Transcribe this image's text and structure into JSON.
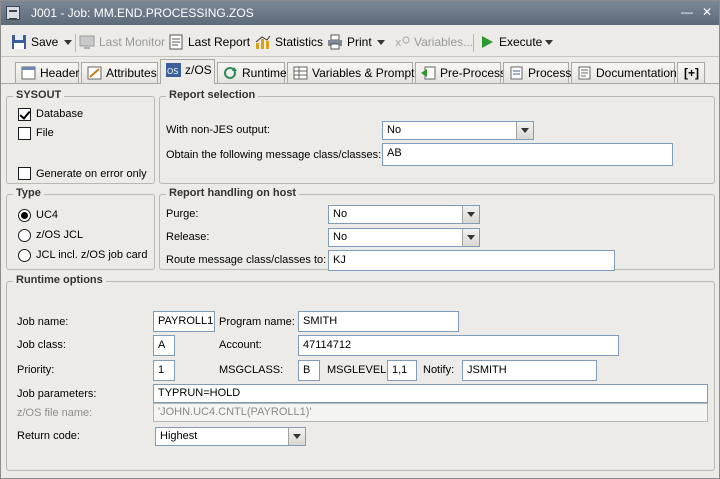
{
  "window": {
    "title": "J001 - Job: MM.END.PROCESSING.ZOS",
    "minimize": "—",
    "close": "✕"
  },
  "toolbar": {
    "save": "Save",
    "last_monitor": "Last Monitor",
    "last_report": "Last Report",
    "statistics": "Statistics",
    "print": "Print",
    "variables": "Variables...",
    "execute": "Execute"
  },
  "tabs": [
    "Header",
    "Attributes",
    "z/OS",
    "Runtime",
    "Variables & Prompts",
    "Pre-Process",
    "Process",
    "Documentation",
    "[+]"
  ],
  "sysout": {
    "title": "SYSOUT",
    "database": {
      "label": "Database",
      "checked": true
    },
    "file": {
      "label": "File",
      "checked": false
    },
    "generate_on_error": {
      "label": "Generate on error only",
      "checked": false
    }
  },
  "report_selection": {
    "title": "Report selection",
    "non_jes_label": "With non-JES output:",
    "non_jes_value": "No",
    "message_class_label": "Obtain the following message class/classes:",
    "message_class_value": "AB"
  },
  "type": {
    "title": "Type",
    "options": [
      "UC4",
      "z/OS JCL",
      "JCL incl. z/OS job card"
    ],
    "selected": "UC4"
  },
  "report_handling": {
    "title": "Report handling on host",
    "purge_label": "Purge:",
    "purge_value": "No",
    "release_label": "Release:",
    "release_value": "No",
    "route_label": "Route message class/classes to:",
    "route_value": "KJ"
  },
  "runtime": {
    "title": "Runtime options",
    "job_name_label": "Job name:",
    "job_name": "PAYROLL1",
    "program_name_label": "Program name:",
    "program_name": "SMITH",
    "job_class_label": "Job class:",
    "job_class": "A",
    "account_label": "Account:",
    "account": "47114712",
    "priority_label": "Priority:",
    "priority": "1",
    "msgclass_label": "MSGCLASS:",
    "msgclass": "B",
    "msglevel_label": "MSGLEVEL:",
    "msglevel": "1,1",
    "notify_label": "Notify:",
    "notify": "JSMITH",
    "job_params_label": "Job parameters:",
    "job_params": "TYPRUN=HOLD",
    "zos_file_label": "z/OS file name:",
    "zos_file": "'JOHN.UC4.CNTL(PAYROLL1)'",
    "return_code_label": "Return code:",
    "return_code": "Highest"
  }
}
